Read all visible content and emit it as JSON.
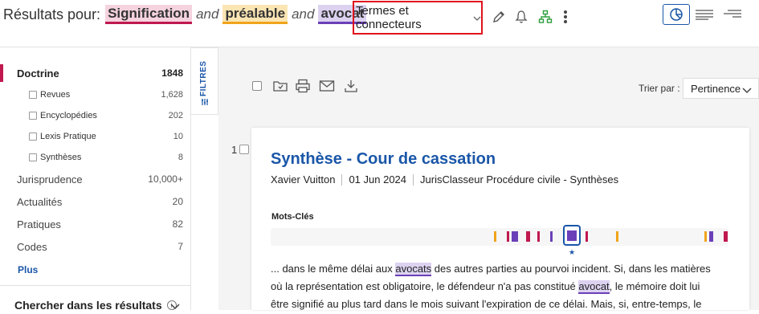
{
  "header": {
    "results_label": "Résultats pour:",
    "terms": [
      {
        "text": "Signification",
        "color": "pink"
      },
      {
        "text": "préalable",
        "color": "yellow"
      },
      {
        "text": "avocat",
        "color": "purple"
      }
    ],
    "connector": "and",
    "mode_select": "Termes et connecteurs",
    "icons": [
      "pencil-icon",
      "bell-icon",
      "hierarchy-icon",
      "more-vertical-icon"
    ],
    "view_icons": [
      "chart-view-icon",
      "list-view-icon",
      "compact-view-icon"
    ],
    "colors": {
      "pink": "#c0184f",
      "yellow": "#f0a41b",
      "purple": "#6b3fb8",
      "accent": "#1a56a8",
      "highlight_frame": "#e0131c"
    }
  },
  "sidebar": {
    "facets": [
      {
        "label": "Doctrine",
        "count": "1848",
        "level": "main",
        "active": true
      },
      {
        "label": "Revues",
        "count": "1,628",
        "level": "sub"
      },
      {
        "label": "Encyclopédies",
        "count": "202",
        "level": "sub"
      },
      {
        "label": "Lexis Pratique",
        "count": "10",
        "level": "sub"
      },
      {
        "label": "Synthèses",
        "count": "8",
        "level": "sub"
      },
      {
        "label": "Jurisprudence",
        "count": "10,000+",
        "level": "main"
      },
      {
        "label": "Actualités",
        "count": "20",
        "level": "main"
      },
      {
        "label": "Pratiques",
        "count": "82",
        "level": "main"
      },
      {
        "label": "Codes",
        "count": "7",
        "level": "main"
      }
    ],
    "more_label": "Plus",
    "search_within_label": "Chercher dans les résultats",
    "info_icon": "i"
  },
  "filters_tab": {
    "label": "FILTRES"
  },
  "toolbar": {
    "icons": [
      "select-all-checkbox",
      "folder-save-icon",
      "print-icon",
      "email-icon",
      "download-icon"
    ],
    "sort_label": "Trier par :",
    "sort_value": "Pertinence"
  },
  "result": {
    "number": "1",
    "title": "Synthèse - Cour de cassation",
    "author": "Xavier Vuitton",
    "date": "01 Jun 2024",
    "source": "JurisClasseur Procédure civile - Synthèses",
    "keywords_label": "Mots-Clés",
    "excerpt": {
      "p1": "... dans le même délai aux ",
      "k1": "avocats",
      "p2": " des autres parties au pourvoi incident. Si, dans les matières où la représentation est obligatoire, le défendeur n'a pas constitué ",
      "k2": "avocat",
      "p3": ", le mémoire doit lui être signifié au plus tard dans le mois suivant l'expiration de ce délai. Mais, si, entre-temps, le"
    }
  }
}
